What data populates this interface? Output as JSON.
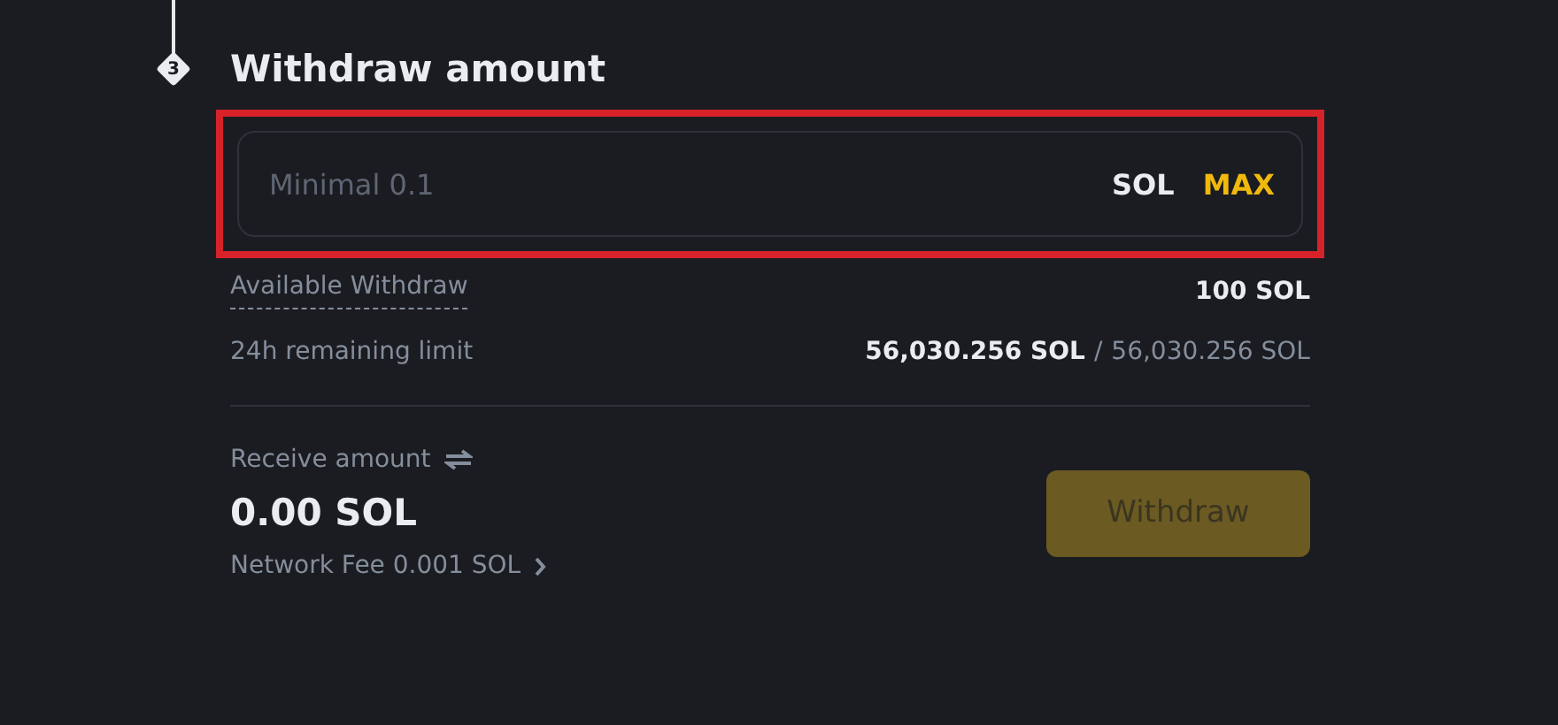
{
  "step": {
    "number": "3",
    "title": "Withdraw amount"
  },
  "amount_field": {
    "placeholder": "Minimal 0.1",
    "unit": "SOL",
    "max_label": "MAX",
    "highlighted": true
  },
  "available": {
    "label": "Available Withdraw",
    "value": "100 SOL"
  },
  "remaining_limit": {
    "label": "24h remaining limit",
    "used": "56,030.256 SOL",
    "separator": "/",
    "total": "56,030.256 SOL"
  },
  "receive": {
    "label": "Receive amount",
    "amount": "0.00 SOL",
    "fee": "Network Fee 0.001 SOL"
  },
  "withdraw_button": {
    "label": "Withdraw",
    "disabled": true
  }
}
